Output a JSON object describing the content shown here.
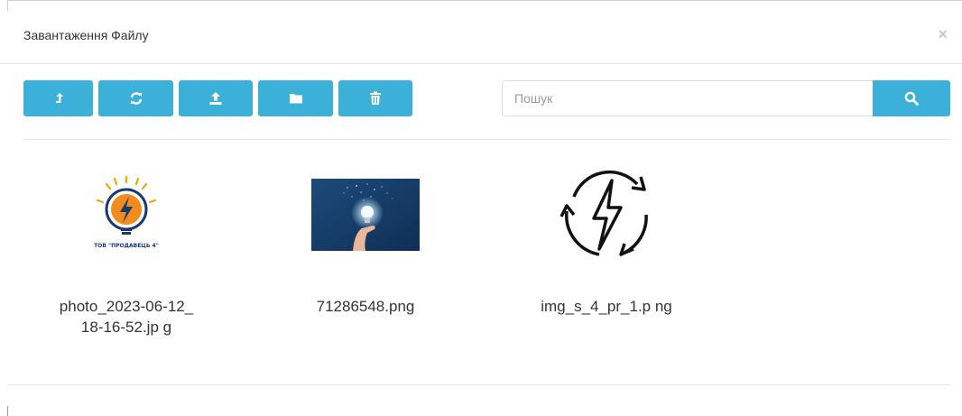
{
  "dialog": {
    "title": "Завантаження Файлу",
    "close_glyph": "×"
  },
  "toolbar": {
    "buttons": [
      {
        "name": "parent-directory-button",
        "icon": "level-up-icon"
      },
      {
        "name": "refresh-button",
        "icon": "refresh-icon"
      },
      {
        "name": "upload-button",
        "icon": "upload-icon"
      },
      {
        "name": "new-folder-button",
        "icon": "folder-icon"
      },
      {
        "name": "delete-button",
        "icon": "trash-icon"
      }
    ],
    "accent": "#3bb1d9"
  },
  "search": {
    "placeholder": "Пошук",
    "value": "",
    "icon": "search-icon"
  },
  "files": [
    {
      "name": "photo_2023-06-12_18-16-52.jp g",
      "thumb": "company-logo",
      "logo_text": "ТОВ \"ПРОДАВЕЦЬ 4\""
    },
    {
      "name": "71286548.png",
      "thumb": "lightbulb-photo"
    },
    {
      "name": "img_s_4_pr_1.p ng",
      "thumb": "lightning-cycle-icon"
    }
  ]
}
